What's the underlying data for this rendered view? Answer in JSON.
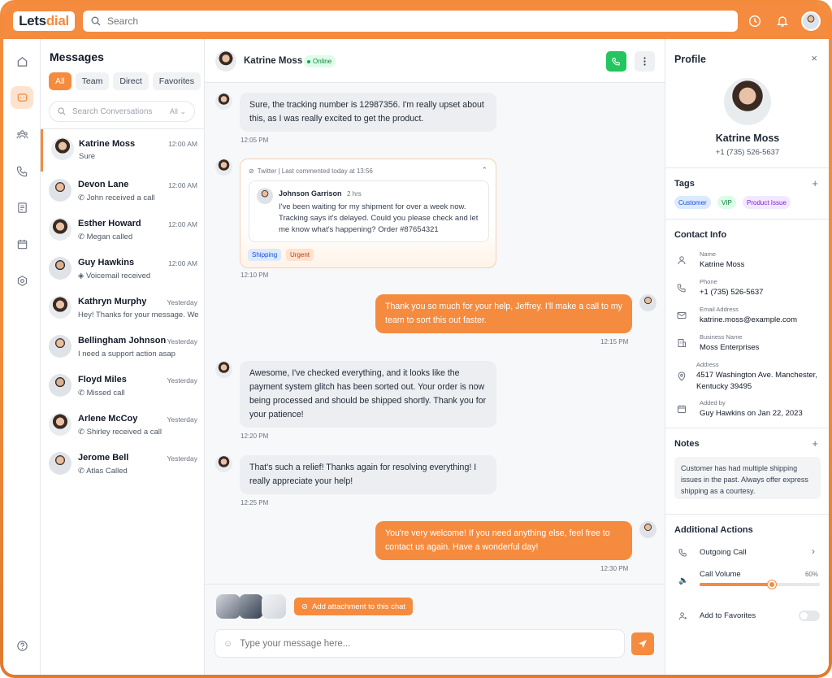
{
  "app": {
    "logo_part1": "Lets",
    "logo_part2": "dial"
  },
  "search": {
    "placeholder": "Search"
  },
  "messages_panel": {
    "title": "Messages",
    "filters": [
      "All",
      "Team",
      "Direct",
      "Favorites"
    ],
    "active_filter": "All",
    "search_placeholder": "Search Conversations",
    "search_filter": "All",
    "conversations": [
      {
        "name": "Katrine Moss",
        "time": "12:00 AM",
        "preview": "Sure",
        "icon": "",
        "selected": true
      },
      {
        "name": "Devon Lane",
        "time": "12:00 AM",
        "preview": "John received a call",
        "icon": "phone-icon"
      },
      {
        "name": "Esther Howard",
        "time": "12:00 AM",
        "preview": "Megan called",
        "icon": "phone-icon"
      },
      {
        "name": "Guy Hawkins",
        "time": "12:00 AM",
        "preview": "Voicemail received",
        "icon": "voicemail-icon"
      },
      {
        "name": "Kathryn Murphy",
        "time": "Yesterday",
        "preview": "Hey! Thanks for your message. We",
        "icon": ""
      },
      {
        "name": "Bellingham Johnson",
        "time": "Yesterday",
        "preview": "I need a support action asap",
        "icon": ""
      },
      {
        "name": "Floyd Miles",
        "time": "Yesterday",
        "preview": "Missed call",
        "icon": "phone-icon"
      },
      {
        "name": "Arlene McCoy",
        "time": "Yesterday",
        "preview": "Shirley received a call",
        "icon": "phone-icon"
      },
      {
        "name": "Jerome Bell",
        "time": "Yesterday",
        "preview": "Atlas Called",
        "icon": "phone-icon"
      }
    ]
  },
  "chat": {
    "contact_name": "Katrine Moss",
    "status": "Online",
    "messages": [
      {
        "dir": "in",
        "text": "Sure, the tracking number is 12987356. I'm really upset about this, as I was really excited to get the product.",
        "time": "12:05 PM"
      },
      {
        "dir": "in",
        "text": "Awesome, I've checked everything, and it looks like the payment system glitch has been sorted out. Your order is now being processed and should be shipped shortly. Thank you for your patience!",
        "time": "12:20 PM"
      },
      {
        "dir": "in",
        "text": "That's such a relief! Thanks again for resolving everything! I really appreciate your help!",
        "time": "12:25 PM"
      }
    ],
    "outgoing": [
      {
        "dir": "out",
        "text": "Thank you so much for your help, Jeffrey. I'll make a call to my team to sort this out faster.",
        "time": "12:15 PM"
      },
      {
        "dir": "out",
        "text": "You're very welcome! If you need anything else, feel free to contact us again. Have a wonderful day!",
        "time": "12:30 PM"
      }
    ],
    "social_card": {
      "source": "Twitter | Last commented today at 13:56",
      "author": "Johnson Garrison",
      "age": "2 hrs",
      "text": "I've been waiting for my shipment for over a week now. Tracking says it's delayed. Could you please check and let me know what's happening? Order #87654321",
      "tags": [
        "Shipping",
        "Urgent"
      ],
      "time": "12:10 PM"
    },
    "attach_label": "Add attachment to this chat",
    "input_placeholder": "Type your message here..."
  },
  "profile": {
    "title": "Profile",
    "name": "Katrine Moss",
    "phone": "+1 (735) 526-5637",
    "tags_title": "Tags",
    "tags": [
      "Customer",
      "VIP",
      "Product Issue"
    ],
    "contact_title": "Contact Info",
    "contact": [
      {
        "label": "Name",
        "value": "Katrine Moss",
        "icon": "user-icon"
      },
      {
        "label": "Phone",
        "value": "+1 (735) 526-5637",
        "icon": "phone-icon"
      },
      {
        "label": "Email Address",
        "value": "katrine.moss@example.com",
        "icon": "mail-icon"
      },
      {
        "label": "Business Name",
        "value": "Moss Enterprises",
        "icon": "building-icon"
      },
      {
        "label": "Address",
        "value": "4517 Washington Ave. Manchester, Kentucky 39495",
        "icon": "location-icon"
      },
      {
        "label": "Added by",
        "value": "Guy Hawkins on Jan 22, 2023",
        "icon": "calendar-icon"
      }
    ],
    "notes_title": "Notes",
    "note": "Customer has had multiple shipping issues in the past. Always offer express shipping as a courtesy.",
    "actions_title": "Additional Actions",
    "outgoing_call": "Outgoing Call",
    "call_volume_label": "Call Volume",
    "call_volume_value": "60%",
    "call_volume": 0.6,
    "favorites_label": "Add to Favorites",
    "favorites_on": false
  },
  "colors": {
    "accent": "#f58b3f",
    "green": "#22c55e"
  }
}
